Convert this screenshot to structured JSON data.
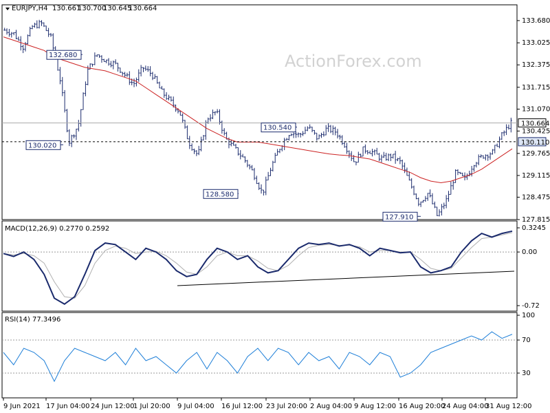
{
  "panels": {
    "price": {
      "header": {
        "symbol": "EURJPY,H4",
        "open": "130.661",
        "high": "130.700",
        "low": "130.645",
        "close": "130.664"
      },
      "watermark": "ActionForex.com",
      "current_price": "130.664",
      "level_price": "130.110"
    },
    "macd": {
      "header": "MACD(12,26,9) 0.2770 0.2592"
    },
    "rsi": {
      "header": "RSI(14) 77.3496"
    }
  },
  "chart_data": [
    {
      "type": "line",
      "panel": "price",
      "title": "EURJPY,H4",
      "ylim": [
        127.815,
        133.8
      ],
      "y_ticks": [
        "133.680",
        "133.025",
        "132.375",
        "131.715",
        "131.070",
        "130.425",
        "129.765",
        "129.115",
        "128.475",
        "127.815"
      ],
      "x_ticks": [
        "9 Jun 2021",
        "17 Jun 04:00",
        "24 Jun 12:00",
        "1 Jul 20:00",
        "9 Jul 04:00",
        "16 Jul 12:00",
        "23 Jul 20:00",
        "2 Aug 04:00",
        "9 Aug 12:00",
        "16 Aug 20:00",
        "24 Aug 04:00",
        "31 Aug 12:00"
      ],
      "series": [
        {
          "values": [
            133.4,
            133.3,
            132.9,
            133.5,
            133.6,
            133.2,
            132.0,
            130.1,
            130.6,
            132.2,
            132.68,
            132.5,
            132.4,
            132.1,
            131.8,
            132.3,
            132.1,
            131.6,
            131.3,
            131.0,
            130.1,
            129.7,
            130.8,
            131.0,
            130.2,
            129.9,
            129.6,
            129.2,
            128.58,
            129.4,
            130.0,
            130.4,
            130.3,
            130.54,
            130.2,
            130.5,
            130.4,
            130.0,
            129.5,
            129.9,
            129.8,
            129.6,
            129.7,
            129.5,
            128.9,
            128.3,
            128.6,
            127.91,
            128.4,
            129.2,
            129.0,
            129.5,
            129.7,
            129.8,
            130.3,
            130.664
          ]
        },
        {
          "values": [
            133.2,
            133.1,
            133.0,
            132.9,
            132.8,
            132.6,
            132.5,
            132.4,
            132.3,
            132.25,
            132.2,
            132.1,
            132.0,
            131.9,
            131.7,
            131.5,
            131.3,
            131.1,
            130.9,
            130.7,
            130.5,
            130.35,
            130.2,
            130.1,
            130.1,
            130.1,
            130.05,
            130.0,
            129.95,
            129.9,
            129.85,
            129.8,
            129.75,
            129.72,
            129.7,
            129.65,
            129.6,
            129.5,
            129.4,
            129.3,
            129.2,
            129.05,
            128.95,
            128.9,
            128.95,
            129.05,
            129.15,
            129.3,
            129.5,
            129.7,
            129.9
          ]
        }
      ],
      "annotations": [
        "132.680",
        "130.020",
        "128.580",
        "130.540",
        "127.910"
      ]
    },
    {
      "type": "line",
      "panel": "macd",
      "title": "MACD(12,26,9) 0.2770 0.2592",
      "ylim": [
        -0.72,
        0.3245
      ],
      "y_ticks": [
        "0.3245",
        "0.00",
        "-0.72"
      ],
      "series": [
        {
          "values": [
            -0.02,
            -0.06,
            0.0,
            -0.1,
            -0.3,
            -0.62,
            -0.7,
            -0.6,
            -0.3,
            0.02,
            0.12,
            0.1,
            0.0,
            -0.1,
            0.05,
            0.0,
            -0.1,
            -0.25,
            -0.33,
            -0.3,
            -0.1,
            0.05,
            0.0,
            -0.1,
            -0.05,
            -0.2,
            -0.28,
            -0.25,
            -0.1,
            0.05,
            0.12,
            0.1,
            0.12,
            0.08,
            0.1,
            0.05,
            -0.05,
            0.05,
            0.02,
            -0.01,
            0.0,
            -0.2,
            -0.28,
            -0.25,
            -0.2,
            0.0,
            0.15,
            0.25,
            0.2,
            0.25,
            0.28
          ]
        },
        {
          "values": [
            -0.02,
            -0.04,
            -0.02,
            -0.05,
            -0.15,
            -0.4,
            -0.6,
            -0.62,
            -0.45,
            -0.15,
            0.02,
            0.08,
            0.05,
            -0.02,
            0.0,
            0.01,
            -0.05,
            -0.15,
            -0.27,
            -0.3,
            -0.2,
            -0.05,
            0.0,
            -0.05,
            -0.05,
            -0.12,
            -0.22,
            -0.25,
            -0.18,
            -0.05,
            0.06,
            0.09,
            0.1,
            0.09,
            0.09,
            0.07,
            0.0,
            0.02,
            0.02,
            0.0,
            0.0,
            -0.1,
            -0.22,
            -0.25,
            -0.22,
            -0.08,
            0.06,
            0.18,
            0.2,
            0.23,
            0.26
          ]
        }
      ]
    },
    {
      "type": "line",
      "panel": "rsi",
      "title": "RSI(14) 77.3496",
      "ylim": [
        0,
        100
      ],
      "y_ticks": [
        "100",
        "70",
        "30"
      ],
      "series": [
        {
          "values": [
            55,
            40,
            60,
            55,
            45,
            20,
            45,
            60,
            55,
            50,
            45,
            55,
            40,
            60,
            45,
            50,
            40,
            30,
            45,
            55,
            35,
            55,
            45,
            30,
            50,
            60,
            45,
            60,
            55,
            40,
            55,
            45,
            50,
            35,
            55,
            50,
            40,
            55,
            50,
            25,
            30,
            40,
            55,
            60,
            65,
            70,
            75,
            70,
            80,
            72,
            77
          ]
        }
      ]
    }
  ]
}
